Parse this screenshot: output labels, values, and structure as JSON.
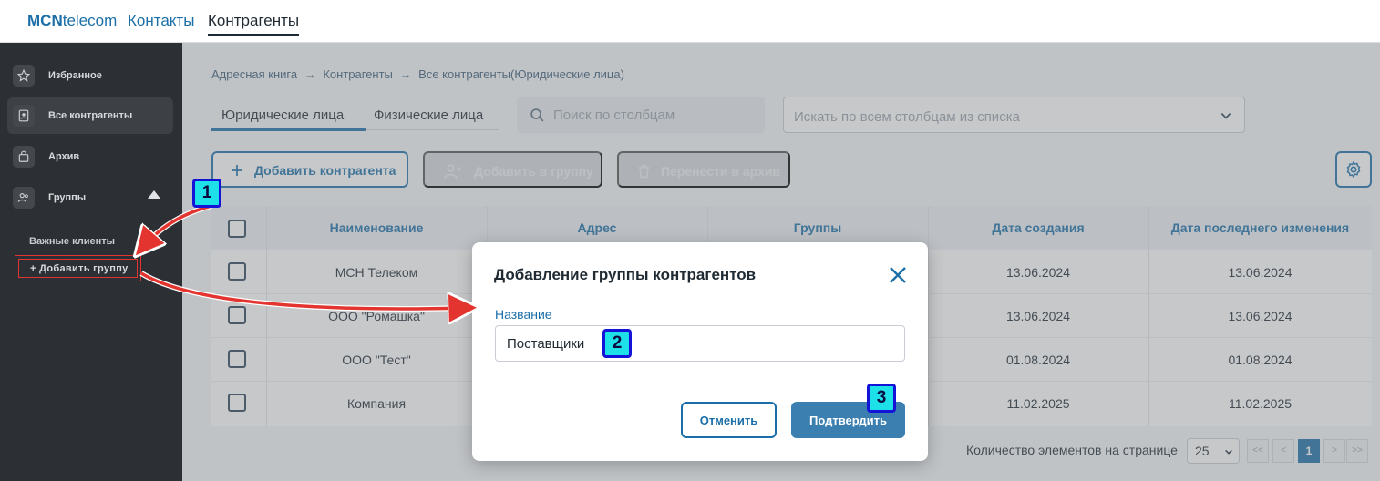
{
  "header": {
    "logo_bold": "MCN",
    "logo_rest": "telecom",
    "nav": [
      "Контакты",
      "Контрагенты"
    ]
  },
  "sidebar": {
    "items": [
      {
        "label": "Избранное",
        "icon": "star-icon"
      },
      {
        "label": "Все контрагенты",
        "icon": "contact-card-icon"
      },
      {
        "label": "Архив",
        "icon": "archive-bag-icon"
      },
      {
        "label": "Группы",
        "icon": "group-users-icon"
      }
    ],
    "subgroups": [
      "Важные клиенты"
    ],
    "add_group": "+ Добавить группу"
  },
  "breadcrumb": {
    "items": [
      "Адресная книга",
      "Контрагенты",
      "Все контрагенты(Юридические лица)"
    ],
    "separator": "→"
  },
  "tabs": [
    "Юридические лица",
    "Физические лица"
  ],
  "search": {
    "placeholder": "Поиск по столбцам"
  },
  "column_select": {
    "placeholder": "Искать по всем столбцам из списка"
  },
  "toolbar": {
    "add_counterparty": "Добавить контрагента",
    "add_to_group": "Добавить в группу",
    "move_to_archive": "Перенести в архив"
  },
  "table": {
    "columns": [
      "Наименование",
      "Адрес",
      "Группы",
      "Дата создания",
      "Дата последнего изменения"
    ],
    "rows": [
      {
        "name": "МСН Телеком",
        "address": "",
        "groups": "",
        "created": "13.06.2024",
        "modified": "13.06.2024"
      },
      {
        "name": "ООО \"Ромашка\"",
        "address": "",
        "groups": "",
        "created": "13.06.2024",
        "modified": "13.06.2024"
      },
      {
        "name": "ООО \"Тест\"",
        "address": "",
        "groups": "",
        "created": "01.08.2024",
        "modified": "01.08.2024"
      },
      {
        "name": "Компания",
        "address": "",
        "groups": "",
        "created": "11.02.2025",
        "modified": "11.02.2025"
      }
    ]
  },
  "pagination": {
    "label": "Количество элементов на странице",
    "page_size": "25",
    "first": "<<",
    "prev": "<",
    "current_page": "1",
    "next": ">",
    "last": ">>"
  },
  "modal": {
    "title": "Добавление группы контрагентов",
    "field_label": "Название",
    "field_value": "Поставщики",
    "cancel": "Отменить",
    "confirm": "Подтвердить"
  },
  "callouts": [
    "1",
    "2",
    "3"
  ],
  "colors": {
    "accent": "#1b6fa8",
    "sidebar_bg": "#2c2f33",
    "callout_fill": "#1ee0e8",
    "callout_border": "#1414d8",
    "arrow_red": "#e3342f"
  }
}
